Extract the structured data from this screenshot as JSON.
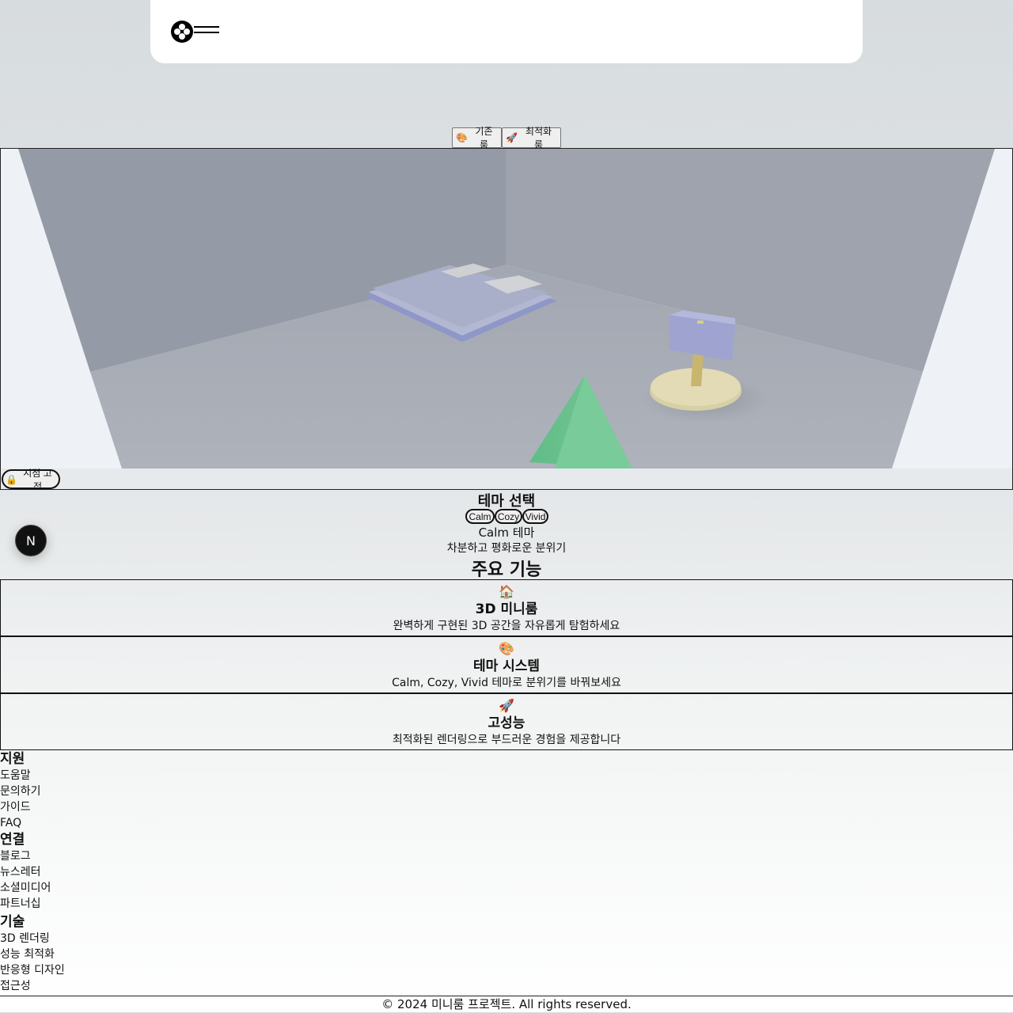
{
  "header": {
    "logo_icon": "flower-logo-icon",
    "menu_icon": "hamburger-menu-icon"
  },
  "room_toggle": {
    "basic": {
      "icon": "🎨",
      "label": "기존 룸"
    },
    "optimized": {
      "icon": "🚀",
      "label": "최적화 룸"
    }
  },
  "viewport": {
    "lock_button": {
      "icon": "🔒",
      "label": "시점 고정"
    }
  },
  "theme": {
    "title": "테마 선택",
    "buttons": [
      "Calm",
      "Cozy",
      "Vivid"
    ],
    "current_name": "Calm 테마",
    "current_desc": "차분하고 평화로운 분위기"
  },
  "features": {
    "title": "주요 기능",
    "items": [
      {
        "icon": "🏠",
        "title": "3D 미니룸",
        "desc": "완벽하게 구현된 3D 공간을 자유롭게 탐험하세요"
      },
      {
        "icon": "🎨",
        "title": "테마 시스템",
        "desc": "Calm, Cozy, Vivid 테마로 분위기를 바꿔보세요"
      },
      {
        "icon": "🚀",
        "title": "고성능",
        "desc": "최적화된 렌더링으로 부드러운 경험을 제공합니다"
      }
    ]
  },
  "footer": {
    "columns": [
      {
        "heading": "지원",
        "links": [
          "도움말",
          "문의하기",
          "가이드",
          "FAQ"
        ]
      },
      {
        "heading": "연결",
        "links": [
          "블로그",
          "뉴스레터",
          "소셜미디어",
          "파트너십"
        ]
      },
      {
        "heading": "기술",
        "links": [
          "3D 렌더링",
          "성능 최적화",
          "반응형 디자인",
          "접근성"
        ]
      }
    ],
    "copyright": "© 2024 미니룸 프로젝트. All rights reserved."
  },
  "dev_badge": {
    "letter": "N"
  }
}
